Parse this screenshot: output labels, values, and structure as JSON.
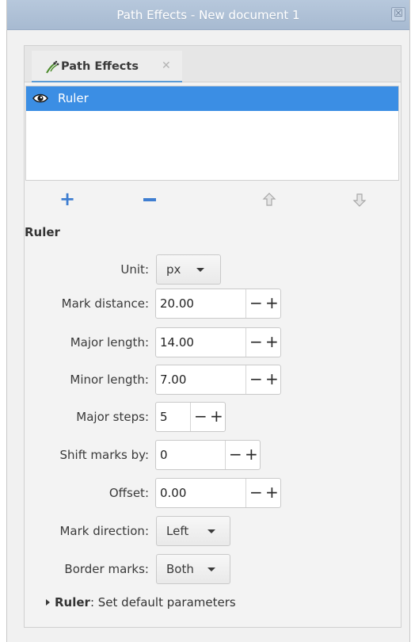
{
  "window": {
    "title": "Path Effects - New document 1",
    "close_glyph": "☒"
  },
  "tab": {
    "label": "Path Effects",
    "close_glyph": "✕",
    "icon": "path-effects-icon"
  },
  "effects_list": {
    "items": [
      {
        "label": "Ruler",
        "visible_icon": "eye-icon",
        "selected": true
      }
    ]
  },
  "actions": {
    "add_glyph": "+",
    "remove_icon": "minus-icon",
    "up_icon": "arrow-up-icon",
    "down_icon": "arrow-down-icon"
  },
  "section": {
    "title": "Ruler"
  },
  "params": {
    "unit": {
      "label": "Unit:",
      "value": "px"
    },
    "mark_distance": {
      "label": "Mark distance:",
      "value": "20.00"
    },
    "major_length": {
      "label": "Major length:",
      "value": "14.00"
    },
    "minor_length": {
      "label": "Minor length:",
      "value": "7.00"
    },
    "major_steps": {
      "label": "Major steps:",
      "value": "5"
    },
    "shift_marks": {
      "label": "Shift marks by:",
      "value": "0"
    },
    "offset": {
      "label": "Offset:",
      "value": "0.00"
    },
    "mark_direction": {
      "label": "Mark direction:",
      "value": "Left"
    },
    "border_marks": {
      "label": "Border marks:",
      "value": "Both"
    }
  },
  "spin_glyphs": {
    "minus": "−",
    "plus": "+"
  },
  "expander": {
    "bold": "Ruler",
    "rest": ": Set default parameters"
  },
  "colors": {
    "selection": "#3b8ee4",
    "accent_blue": "#3f7ed1",
    "titlebar": "#afc1d7"
  }
}
